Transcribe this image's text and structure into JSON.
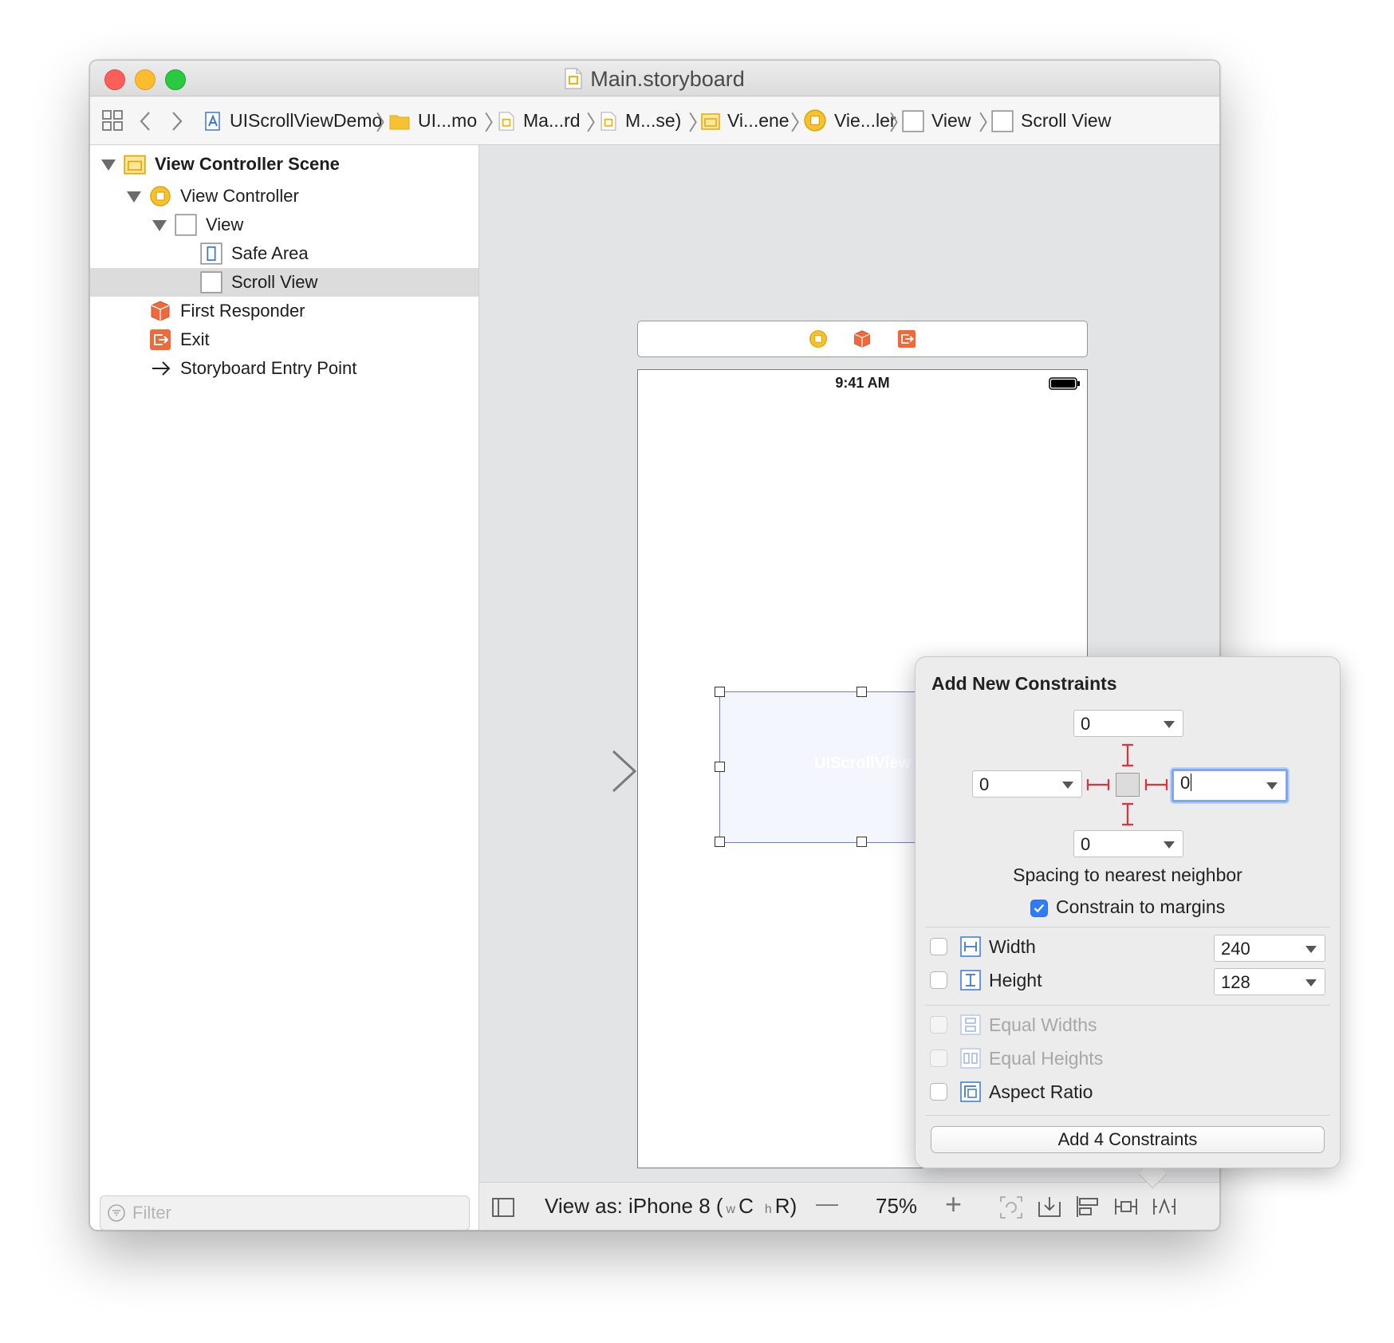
{
  "window": {
    "title": "Main.storyboard"
  },
  "breadcrumb": [
    {
      "label": "UIScrollViewDemo",
      "icon": "app-project-icon"
    },
    {
      "label": "UI...mo",
      "icon": "folder-icon"
    },
    {
      "label": "Ma...rd",
      "icon": "storyboard-file-icon"
    },
    {
      "label": "M...se)",
      "icon": "storyboard-file-icon"
    },
    {
      "label": "Vi...ene",
      "icon": "scene-icon"
    },
    {
      "label": "Vie...ler",
      "icon": "view-controller-icon"
    },
    {
      "label": "View",
      "icon": "view-icon"
    },
    {
      "label": "Scroll View",
      "icon": "view-icon"
    }
  ],
  "navigator": {
    "items": [
      {
        "label": "View Controller Scene",
        "icon": "scene-icon"
      },
      {
        "label": "View Controller",
        "icon": "view-controller-icon"
      },
      {
        "label": "View",
        "icon": "view-icon"
      },
      {
        "label": "Safe Area",
        "icon": "safe-area-icon"
      },
      {
        "label": "Scroll View",
        "icon": "view-icon",
        "selected": true
      },
      {
        "label": "First Responder",
        "icon": "first-responder-icon"
      },
      {
        "label": "Exit",
        "icon": "exit-icon"
      },
      {
        "label": "Storyboard Entry Point",
        "icon": "arrow-right-icon"
      }
    ],
    "filter_placeholder": "Filter"
  },
  "canvas": {
    "status_time": "9:41 AM",
    "scroll_view_placeholder": "UIScrollView"
  },
  "bottom_bar": {
    "view_as_label": "View as: iPhone 8 (",
    "size_w": "w",
    "size_c": "C",
    "size_h": "h",
    "size_r": "R",
    "size_close": ")",
    "zoom_out": "—",
    "zoom": "75%",
    "zoom_in": "+"
  },
  "constraints_popover": {
    "title": "Add New Constraints",
    "top": "0",
    "left": "0",
    "right": "0",
    "bottom": "0",
    "spacing_label": "Spacing to nearest neighbor",
    "constrain_to_margins_label": "Constrain to margins",
    "constrain_to_margins_checked": true,
    "width_label": "Width",
    "width_value": "240",
    "height_label": "Height",
    "height_value": "128",
    "equal_widths_label": "Equal Widths",
    "equal_heights_label": "Equal Heights",
    "aspect_ratio_label": "Aspect Ratio",
    "add_button_label": "Add 4 Constraints"
  },
  "colors": {
    "accent_blue": "#2f7cf6",
    "constraint_red": "#e0323a",
    "scene_yellow": "#f5b400",
    "exit_orange": "#ef6a3a"
  }
}
